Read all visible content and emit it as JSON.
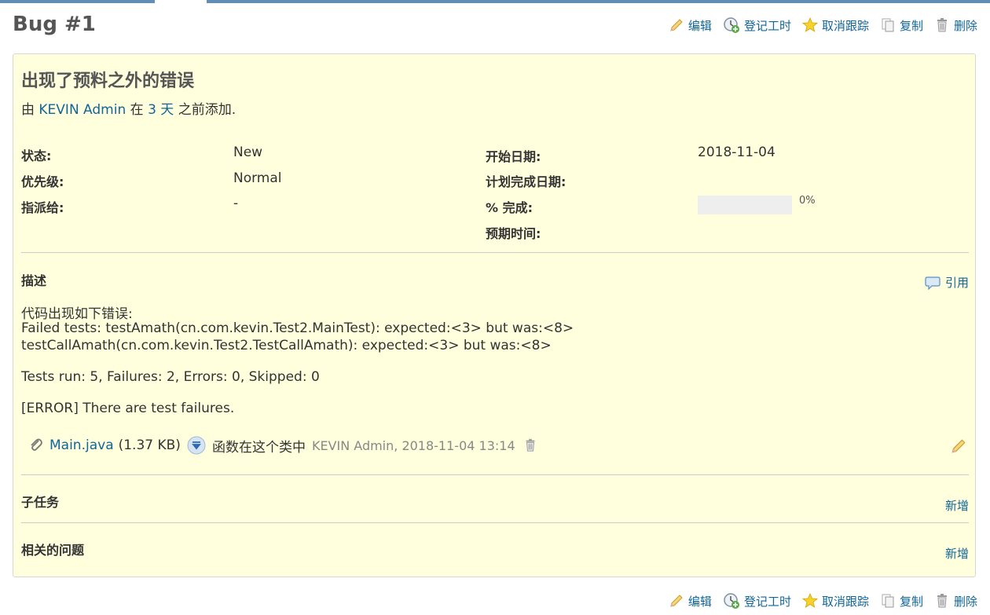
{
  "page": {
    "title": "Bug #1"
  },
  "actions": {
    "edit": "编辑",
    "log_time": "登记工时",
    "unwatch": "取消跟踪",
    "copy": "复制",
    "delete": "删除"
  },
  "issue": {
    "subject": "出现了预料之外的错误",
    "author_prefix": "由",
    "author": "KEVIN Admin",
    "author_mid": "在",
    "time_ago": "3 天",
    "author_suffix": "之前添加."
  },
  "attributes": {
    "status_label": "状态:",
    "status_value": "New",
    "priority_label": "优先级:",
    "priority_value": "Normal",
    "assignee_label": "指派给:",
    "assignee_value": "-",
    "start_date_label": "开始日期:",
    "start_date_value": "2018-11-04",
    "due_date_label": "计划完成日期:",
    "done_ratio_label": "% 完成:",
    "done_ratio": 0,
    "done_ratio_text": "0%",
    "estimated_label": "预期时间:"
  },
  "description": {
    "title": "描述",
    "quote": "引用",
    "lines": [
      "代码出现如下错误:",
      "Failed tests: testAmath(cn.com.kevin.Test2.MainTest): expected:<3> but was:<8>",
      "testCallAmath(cn.com.kevin.Test2.TestCallAmath): expected:<3> but was:<8>",
      "Tests run: 5, Failures: 2, Errors: 0, Skipped: 0",
      "[ERROR] There are test failures."
    ]
  },
  "attachment": {
    "filename": "Main.java",
    "size": "(1.37 KB)",
    "description": "函数在这个类中",
    "author_date": "KEVIN Admin, 2018-11-04 13:14"
  },
  "subtasks": {
    "title": "子任务",
    "add": "新增"
  },
  "relations": {
    "title": "相关的问题",
    "add": "新增"
  },
  "colors": {
    "link": "#116699",
    "box_bg": "#ffffdd",
    "topbar": "#628db6"
  }
}
